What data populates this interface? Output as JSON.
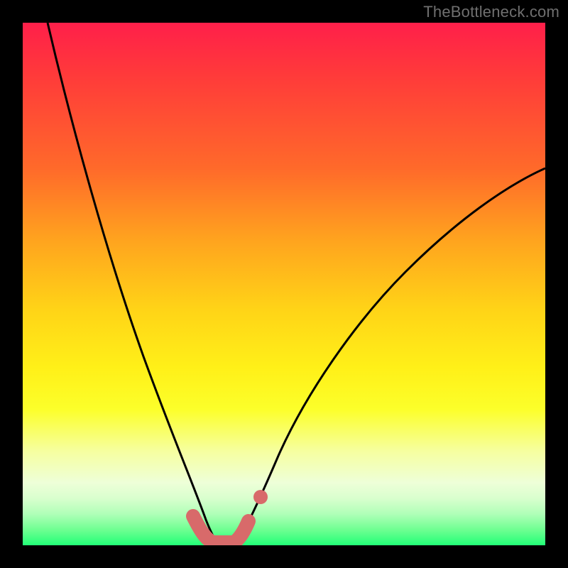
{
  "watermark": "TheBottleneck.com",
  "chart_data": {
    "type": "line",
    "title": "",
    "xlabel": "",
    "ylabel": "",
    "xlim": [
      0,
      100
    ],
    "ylim": [
      0,
      100
    ],
    "series": [
      {
        "name": "left-curve",
        "x": [
          0,
          5,
          10,
          15,
          20,
          25,
          28,
          30,
          32,
          34,
          35
        ],
        "values": [
          100,
          80,
          60,
          42,
          28,
          15,
          7,
          4,
          2,
          1,
          0
        ]
      },
      {
        "name": "right-curve",
        "x": [
          38,
          40,
          42,
          45,
          50,
          55,
          60,
          70,
          80,
          90,
          100
        ],
        "values": [
          0,
          2,
          5,
          10,
          18,
          26,
          33,
          46,
          56,
          64,
          70
        ]
      },
      {
        "name": "optimal-zone",
        "x": [
          30,
          32,
          34,
          36,
          38,
          40,
          42
        ],
        "values": [
          3,
          1,
          0,
          0,
          0,
          1,
          3
        ]
      }
    ],
    "background_gradient": {
      "top": "#ff1f4a",
      "upper": "#ffa51e",
      "mid": "#fff018",
      "lower": "#d9ffce",
      "bottom": "#22ff77"
    },
    "highlight_color": "#d86a6a",
    "curve_color": "#000000"
  }
}
